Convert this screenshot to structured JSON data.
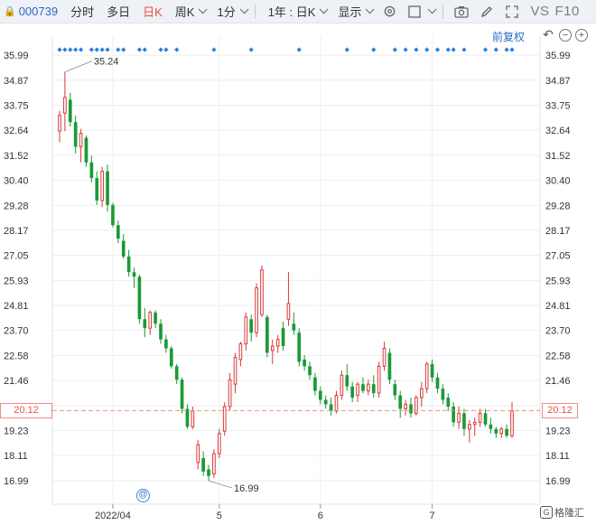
{
  "toolbar": {
    "stock_code": "000739",
    "tabs": [
      "分时",
      "多日",
      "日K"
    ],
    "active_tab": "日K",
    "period_select": "周K",
    "minute_select": "1分",
    "range_select": "1年 : 日K",
    "display_select": "显示",
    "compare_label": "VS",
    "f10_label": "F10",
    "icons": [
      "settings-icon",
      "checkbox-icon",
      "camera-icon",
      "draw-pen-icon",
      "fullscreen-icon"
    ]
  },
  "controls": {
    "fuquan_label": "前复权",
    "icons": [
      "undo-icon",
      "zoom-out-icon",
      "zoom-in-icon"
    ]
  },
  "reference": {
    "price_label": "20.12",
    "value": 20.12
  },
  "extremes": {
    "high_label": "35.24",
    "low_label": "16.99"
  },
  "watermark": {
    "text": "格隆汇"
  },
  "chart_data": {
    "type": "candlestick",
    "y_ticks": [
      "35.99",
      "34.87",
      "33.75",
      "32.64",
      "31.52",
      "30.40",
      "29.28",
      "28.17",
      "27.05",
      "25.93",
      "24.81",
      "23.70",
      "22.58",
      "21.46",
      "20.34",
      "19.23",
      "18.11",
      "16.99"
    ],
    "ylim": [
      16.99,
      35.99
    ],
    "x_labels": [
      {
        "label": "2022/04",
        "index": 10
      },
      {
        "label": "5",
        "index": 30
      },
      {
        "label": "6",
        "index": 49
      },
      {
        "label": "7",
        "index": 70
      }
    ],
    "up_color": "#d9383a",
    "down_color": "#1a9a35",
    "event_marker_color": "#2b7fd9",
    "event_indices": [
      0,
      1,
      2,
      3,
      4,
      6,
      7,
      8,
      9,
      11,
      12,
      15,
      16,
      19,
      20,
      22,
      29,
      36,
      45,
      54,
      59,
      63,
      65,
      67,
      69,
      71,
      73,
      74,
      76,
      80,
      82,
      84,
      85
    ],
    "candles": [
      {
        "o": 32.6,
        "h": 33.5,
        "l": 32.1,
        "c": 33.3
      },
      {
        "o": 33.4,
        "h": 35.24,
        "l": 32.6,
        "c": 34.1
      },
      {
        "o": 34.0,
        "h": 34.3,
        "l": 32.8,
        "c": 33.0
      },
      {
        "o": 33.0,
        "h": 33.3,
        "l": 31.6,
        "c": 31.9
      },
      {
        "o": 31.9,
        "h": 32.7,
        "l": 31.2,
        "c": 32.5
      },
      {
        "o": 32.3,
        "h": 32.4,
        "l": 31.0,
        "c": 31.2
      },
      {
        "o": 31.2,
        "h": 31.5,
        "l": 30.3,
        "c": 30.5
      },
      {
        "o": 30.5,
        "h": 30.8,
        "l": 29.3,
        "c": 29.5
      },
      {
        "o": 29.5,
        "h": 31.0,
        "l": 29.2,
        "c": 30.8
      },
      {
        "o": 30.8,
        "h": 31.1,
        "l": 29.0,
        "c": 29.3
      },
      {
        "o": 29.3,
        "h": 29.4,
        "l": 28.3,
        "c": 28.4
      },
      {
        "o": 28.4,
        "h": 28.6,
        "l": 27.6,
        "c": 27.8
      },
      {
        "o": 27.7,
        "h": 28.0,
        "l": 26.9,
        "c": 27.0
      },
      {
        "o": 27.0,
        "h": 27.3,
        "l": 26.1,
        "c": 26.3
      },
      {
        "o": 26.3,
        "h": 26.5,
        "l": 25.6,
        "c": 26.1
      },
      {
        "o": 26.1,
        "h": 26.2,
        "l": 24.0,
        "c": 24.2
      },
      {
        "o": 24.2,
        "h": 24.7,
        "l": 23.4,
        "c": 23.8
      },
      {
        "o": 23.8,
        "h": 24.6,
        "l": 23.5,
        "c": 24.5
      },
      {
        "o": 24.5,
        "h": 24.6,
        "l": 23.8,
        "c": 24.0
      },
      {
        "o": 24.0,
        "h": 24.2,
        "l": 23.1,
        "c": 23.3
      },
      {
        "o": 23.3,
        "h": 23.5,
        "l": 22.7,
        "c": 22.9
      },
      {
        "o": 22.9,
        "h": 23.0,
        "l": 22.0,
        "c": 22.1
      },
      {
        "o": 22.1,
        "h": 22.2,
        "l": 21.3,
        "c": 21.5
      },
      {
        "o": 21.5,
        "h": 21.6,
        "l": 20.0,
        "c": 20.2
      },
      {
        "o": 20.2,
        "h": 20.4,
        "l": 19.3,
        "c": 19.4
      },
      {
        "o": 19.4,
        "h": 20.3,
        "l": 19.3,
        "c": 20.1
      },
      {
        "o": 17.8,
        "h": 18.8,
        "l": 17.5,
        "c": 18.6
      },
      {
        "o": 18.0,
        "h": 18.3,
        "l": 17.2,
        "c": 17.4
      },
      {
        "o": 17.5,
        "h": 17.7,
        "l": 16.99,
        "c": 17.2
      },
      {
        "o": 17.3,
        "h": 18.4,
        "l": 17.1,
        "c": 18.2
      },
      {
        "o": 18.2,
        "h": 19.3,
        "l": 18.0,
        "c": 19.1
      },
      {
        "o": 19.2,
        "h": 20.5,
        "l": 19.0,
        "c": 20.3
      },
      {
        "o": 20.3,
        "h": 21.8,
        "l": 20.1,
        "c": 21.5
      },
      {
        "o": 21.3,
        "h": 22.7,
        "l": 20.9,
        "c": 22.5
      },
      {
        "o": 22.4,
        "h": 23.2,
        "l": 22.1,
        "c": 23.1
      },
      {
        "o": 23.1,
        "h": 24.5,
        "l": 22.8,
        "c": 24.3
      },
      {
        "o": 24.2,
        "h": 24.4,
        "l": 23.2,
        "c": 23.6
      },
      {
        "o": 23.6,
        "h": 25.8,
        "l": 23.4,
        "c": 25.6
      },
      {
        "o": 24.4,
        "h": 26.6,
        "l": 24.3,
        "c": 26.4
      },
      {
        "o": 24.3,
        "h": 24.4,
        "l": 22.5,
        "c": 22.7
      },
      {
        "o": 22.8,
        "h": 23.3,
        "l": 22.2,
        "c": 23.0
      },
      {
        "o": 23.0,
        "h": 23.5,
        "l": 22.7,
        "c": 23.3
      },
      {
        "o": 23.8,
        "h": 24.1,
        "l": 22.8,
        "c": 23.0
      },
      {
        "o": 24.2,
        "h": 26.3,
        "l": 23.9,
        "c": 24.9
      },
      {
        "o": 24.0,
        "h": 24.5,
        "l": 23.5,
        "c": 23.7
      },
      {
        "o": 23.6,
        "h": 23.8,
        "l": 22.1,
        "c": 22.3
      },
      {
        "o": 22.4,
        "h": 22.6,
        "l": 21.9,
        "c": 22.1
      },
      {
        "o": 22.1,
        "h": 22.3,
        "l": 21.5,
        "c": 21.7
      },
      {
        "o": 21.6,
        "h": 21.8,
        "l": 20.8,
        "c": 21.0
      },
      {
        "o": 21.0,
        "h": 21.2,
        "l": 20.4,
        "c": 20.6
      },
      {
        "o": 20.6,
        "h": 20.8,
        "l": 20.2,
        "c": 20.4
      },
      {
        "o": 20.4,
        "h": 20.7,
        "l": 19.9,
        "c": 20.1
      },
      {
        "o": 20.1,
        "h": 21.0,
        "l": 20.0,
        "c": 20.8
      },
      {
        "o": 20.8,
        "h": 21.9,
        "l": 20.6,
        "c": 21.7
      },
      {
        "o": 21.7,
        "h": 22.2,
        "l": 21.0,
        "c": 21.2
      },
      {
        "o": 21.2,
        "h": 21.4,
        "l": 20.5,
        "c": 20.7
      },
      {
        "o": 20.8,
        "h": 21.4,
        "l": 20.5,
        "c": 21.3
      },
      {
        "o": 21.3,
        "h": 21.6,
        "l": 20.9,
        "c": 21.0
      },
      {
        "o": 21.0,
        "h": 21.5,
        "l": 20.8,
        "c": 21.3
      },
      {
        "o": 21.3,
        "h": 21.7,
        "l": 20.7,
        "c": 20.9
      },
      {
        "o": 20.9,
        "h": 22.3,
        "l": 20.7,
        "c": 22.1
      },
      {
        "o": 22.1,
        "h": 23.2,
        "l": 21.9,
        "c": 22.9
      },
      {
        "o": 22.7,
        "h": 22.9,
        "l": 21.3,
        "c": 21.5
      },
      {
        "o": 21.3,
        "h": 21.5,
        "l": 20.6,
        "c": 20.8
      },
      {
        "o": 20.8,
        "h": 21.0,
        "l": 19.8,
        "c": 20.2
      },
      {
        "o": 20.2,
        "h": 20.6,
        "l": 19.9,
        "c": 20.4
      },
      {
        "o": 20.4,
        "h": 20.7,
        "l": 19.8,
        "c": 20.0
      },
      {
        "o": 20.0,
        "h": 20.8,
        "l": 19.9,
        "c": 20.7
      },
      {
        "o": 20.7,
        "h": 21.4,
        "l": 20.3,
        "c": 21.1
      },
      {
        "o": 21.1,
        "h": 22.3,
        "l": 20.9,
        "c": 22.2
      },
      {
        "o": 22.2,
        "h": 22.4,
        "l": 21.4,
        "c": 21.6
      },
      {
        "o": 21.6,
        "h": 21.8,
        "l": 20.9,
        "c": 21.1
      },
      {
        "o": 21.1,
        "h": 21.3,
        "l": 20.4,
        "c": 20.6
      },
      {
        "o": 20.7,
        "h": 20.9,
        "l": 20.1,
        "c": 20.3
      },
      {
        "o": 20.3,
        "h": 20.5,
        "l": 19.4,
        "c": 19.6
      },
      {
        "o": 19.6,
        "h": 20.3,
        "l": 19.3,
        "c": 20.0
      },
      {
        "o": 20.0,
        "h": 20.2,
        "l": 19.0,
        "c": 19.3
      },
      {
        "o": 19.3,
        "h": 19.7,
        "l": 18.7,
        "c": 19.5
      },
      {
        "o": 19.5,
        "h": 19.8,
        "l": 19.0,
        "c": 19.6
      },
      {
        "o": 19.6,
        "h": 20.2,
        "l": 19.4,
        "c": 20.0
      },
      {
        "o": 20.0,
        "h": 20.2,
        "l": 19.4,
        "c": 19.5
      },
      {
        "o": 19.5,
        "h": 19.8,
        "l": 19.1,
        "c": 19.3
      },
      {
        "o": 19.3,
        "h": 19.4,
        "l": 18.9,
        "c": 19.1
      },
      {
        "o": 19.1,
        "h": 19.4,
        "l": 18.9,
        "c": 19.3
      },
      {
        "o": 19.3,
        "h": 19.5,
        "l": 18.9,
        "c": 19.0
      },
      {
        "o": 19.0,
        "h": 20.5,
        "l": 18.9,
        "c": 20.1
      }
    ]
  }
}
